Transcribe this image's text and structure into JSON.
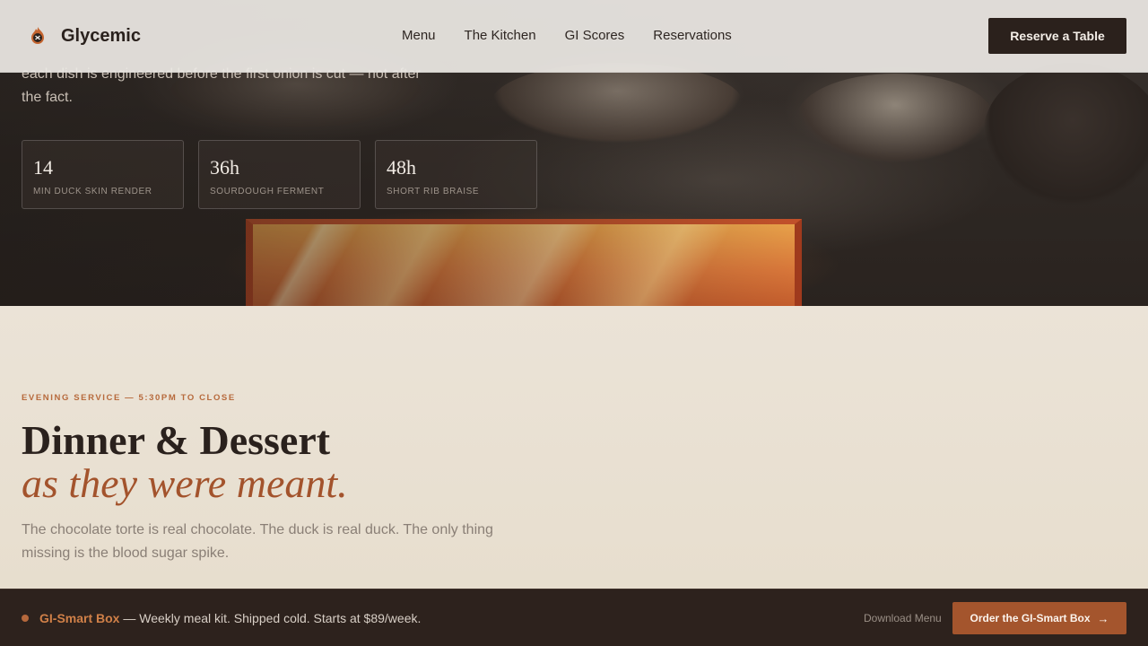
{
  "brand": {
    "name": "Glycemic"
  },
  "nav": {
    "items": [
      "Menu",
      "The Kitchen",
      "GI Scores",
      "Reservations"
    ]
  },
  "header": {
    "cta_label": "Reserve a Table"
  },
  "hero": {
    "copy": "each dish is engineered before the first onion is cut — not after the fact.",
    "stats": [
      {
        "value": "14",
        "label": "MIN DUCK SKIN RENDER"
      },
      {
        "value": "36h",
        "label": "SOURDOUGH FERMENT"
      },
      {
        "value": "48h",
        "label": "SHORT RIB BRAISE"
      }
    ]
  },
  "section": {
    "eyebrow": "EVENING SERVICE — 5:30PM TO CLOSE",
    "title": "Dinner & Dessert",
    "title_accent": "as they were meant.",
    "lead": "The chocolate torte is real chocolate. The duck is real duck. The only thing missing is the blood sugar spike."
  },
  "bottom_bar": {
    "product_name": "GI-Smart Box",
    "product_text": " — Weekly meal kit. Shipped cold. Starts at $89/week.",
    "download_label": "Download Menu",
    "order_label": "Order the GI-Smart Box",
    "order_icon": "arrow-right-icon"
  },
  "colors": {
    "accent": "#a4552d",
    "dark": "#2b211c",
    "cream": "#ece3d6"
  }
}
